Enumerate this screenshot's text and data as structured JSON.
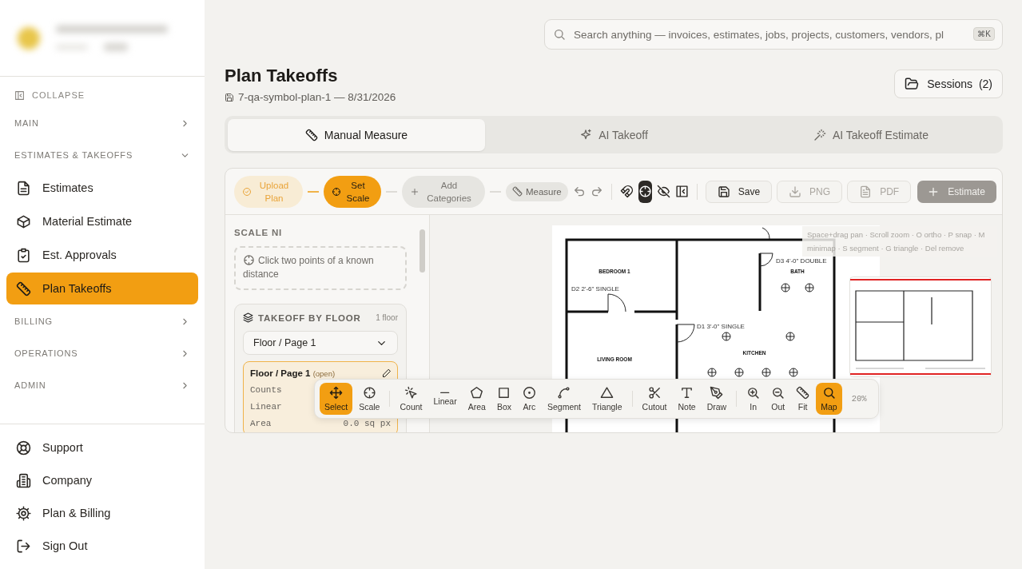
{
  "sidebar": {
    "collapse": "COLLAPSE",
    "sections": [
      {
        "label": "MAIN",
        "expanded": false
      },
      {
        "label": "ESTIMATES & TAKEOFFS",
        "expanded": true,
        "items": [
          {
            "label": "Estimates",
            "selected": false
          },
          {
            "label": "Material Estimate",
            "selected": false
          },
          {
            "label": "Est. Approvals",
            "selected": false
          },
          {
            "label": "Plan Takeoffs",
            "selected": true
          }
        ]
      },
      {
        "label": "BILLING",
        "expanded": false
      },
      {
        "label": "OPERATIONS",
        "expanded": false
      },
      {
        "label": "ADMIN",
        "expanded": false
      }
    ],
    "footer": [
      "Support",
      "Company",
      "Plan & Billing",
      "Sign Out"
    ]
  },
  "search": {
    "placeholder": "Search anything — invoices, estimates, jobs, projects, customers, vendors, pl",
    "shortcut": "⌘K"
  },
  "page": {
    "title": "Plan Takeoffs",
    "subtitle": "7-qa-symbol-plan-1 — 8/31/2026",
    "sessions_label": "Sessions",
    "sessions_count": "(2)"
  },
  "tabs": [
    {
      "label": "Manual Measure",
      "selected": true
    },
    {
      "label": "AI Takeoff",
      "selected": false
    },
    {
      "label": "AI Takeoff Estimate",
      "selected": false
    }
  ],
  "steps": [
    {
      "label": "Upload Plan",
      "completed": true,
      "selected": false
    },
    {
      "label": "Set Scale",
      "completed": false,
      "selected": true
    },
    {
      "label": "Add Categories",
      "completed": false,
      "selected": false
    }
  ],
  "measure_chip": "Measure",
  "view_toggles": [
    {
      "selected": false
    },
    {
      "selected": true
    },
    {
      "selected": false
    },
    {
      "selected": false
    }
  ],
  "actions": [
    {
      "label": "Save",
      "kind": "outline",
      "disabled": false
    },
    {
      "label": "PNG",
      "kind": "outline",
      "disabled": true
    },
    {
      "label": "PDF",
      "kind": "outline",
      "disabled": true
    },
    {
      "label": "Estimate",
      "kind": "primary",
      "disabled": true
    }
  ],
  "scale_panel": {
    "heading": "SCALE NI",
    "hint": "Click two points of a known distance"
  },
  "takeoff": {
    "title": "TAKEOFF BY FLOOR",
    "count": "1 floor",
    "floor_select": "Floor / Page 1",
    "floor": {
      "name": "Floor / Page 1",
      "status": "(open)",
      "selected": true,
      "rows": [
        {
          "label": "Counts"
        },
        {
          "label": "Linear"
        },
        {
          "label": "Area",
          "value": "0.0 sq px"
        }
      ]
    }
  },
  "canvas": {
    "hint": "Space+drag pan · Scroll zoom · O ortho · P snap · M minimap · S segment · G triangle · Del remove",
    "plan_labels": [
      "BEDROOM 1",
      "BATH",
      "LIVING ROOM",
      "KITCHEN"
    ],
    "door_labels": [
      "D2 2'-6\" SINGLE",
      "D3 4'-0\" DOUBLE",
      "D1 3'-0\" SINGLE"
    ]
  },
  "tools": {
    "groups": [
      [
        {
          "label": "Select",
          "selected": true
        },
        {
          "label": "Scale",
          "selected": false
        }
      ],
      [
        {
          "label": "Count",
          "selected": false
        },
        {
          "label": "Linear",
          "selected": false
        },
        {
          "label": "Area",
          "selected": false
        },
        {
          "label": "Box",
          "selected": false
        },
        {
          "label": "Arc",
          "selected": false
        },
        {
          "label": "Segment",
          "selected": false
        },
        {
          "label": "Triangle",
          "selected": false
        }
      ],
      [
        {
          "label": "Cutout",
          "selected": false
        },
        {
          "label": "Note",
          "selected": false
        },
        {
          "label": "Draw",
          "selected": false
        }
      ],
      [
        {
          "label": "In",
          "selected": false
        },
        {
          "label": "Out",
          "selected": false
        },
        {
          "label": "Fit",
          "selected": false
        },
        {
          "label": "Map",
          "selected": true
        }
      ]
    ],
    "zoom": "20%"
  }
}
